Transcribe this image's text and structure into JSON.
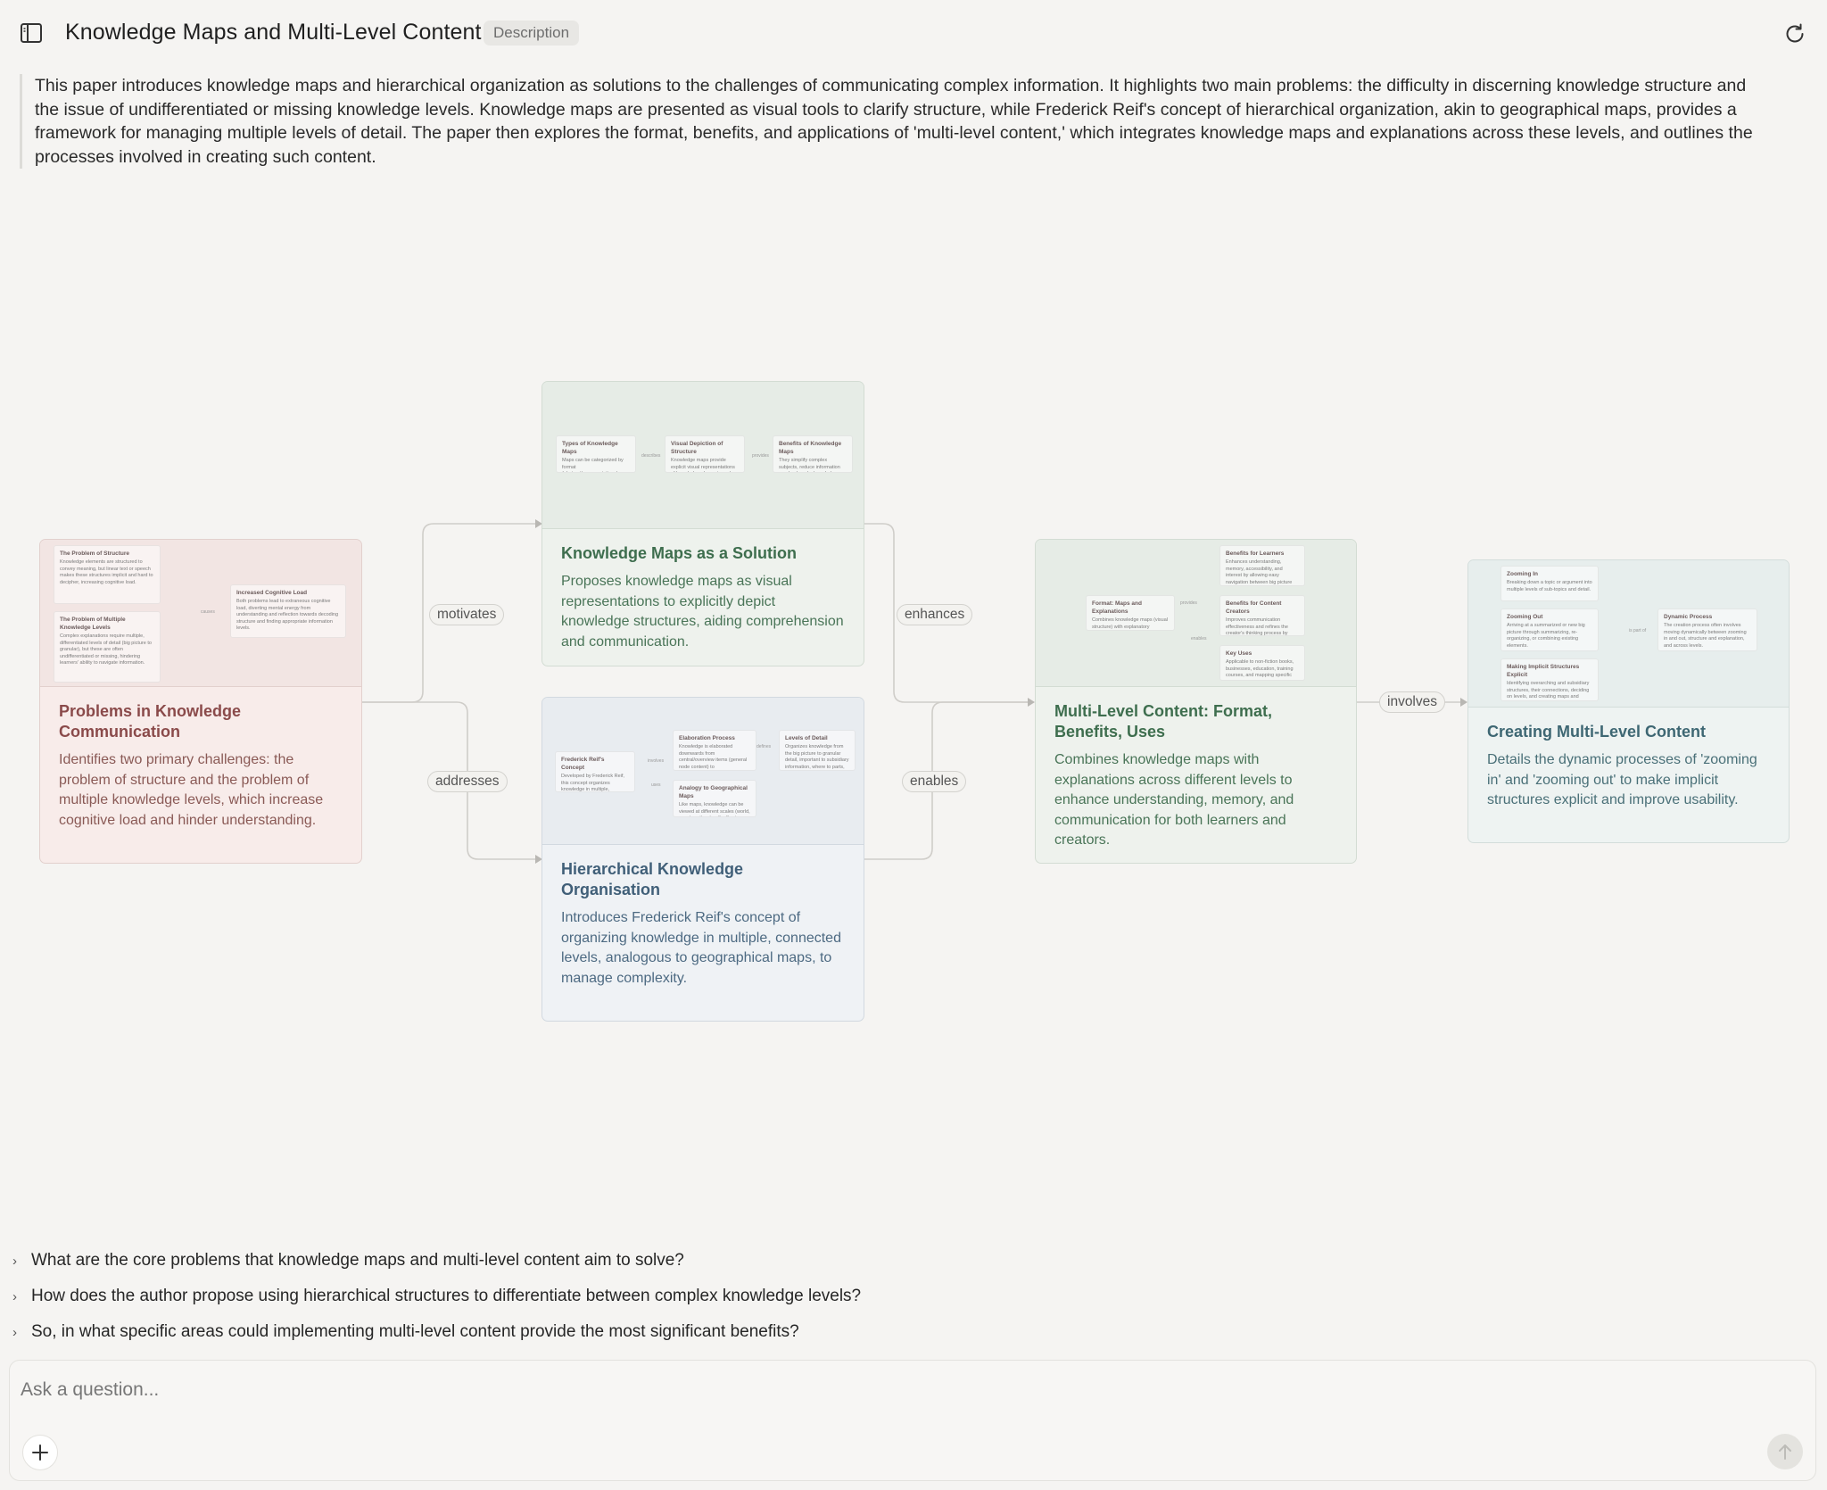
{
  "header": {
    "title": "Knowledge Maps and Multi-Level Content",
    "tag": "Description"
  },
  "description": "This paper introduces knowledge maps and hierarchical organization as solutions to the challenges of communicating complex information. It highlights two main problems: the difficulty in discerning knowledge structure and the issue of undifferentiated or missing knowledge levels. Knowledge maps are presented as visual tools to clarify structure, while Frederick Reif's concept of hierarchical organization, akin to geographical maps, provides a framework for managing multiple levels of detail. The paper then explores the format, benefits, and applications of 'multi-level content,' which integrates knowledge maps and explanations across these levels, and outlines the processes involved in creating such content.",
  "edges": {
    "motivates": "motivates",
    "addresses": "addresses",
    "enhances": "enhances",
    "enables": "enables",
    "involves": "involves"
  },
  "nodes": {
    "problems": {
      "title": "Problems in Knowledge Communication",
      "desc": "Identifies two primary challenges: the problem of structure and the problem of multiple knowledge levels, which increase cognitive load and hinder understanding.",
      "preview": {
        "c1": {
          "t": "The Problem of Structure",
          "d": "Knowledge elements are structured to convey meaning, but linear text or speech makes these structures implicit and hard to decipher, increasing cognitive load."
        },
        "c2": {
          "t": "The Problem of Multiple Knowledge Levels",
          "d": "Complex explanations require multiple, differentiated levels of detail (big picture to granular), but these are often undifferentiated or missing, hindering learners' ability to navigate information."
        },
        "c3": {
          "t": "Increased Cognitive Load",
          "d": "Both problems lead to extraneous cognitive load, diverting mental energy from understanding and reflection towards decoding structure and finding appropriate information levels."
        },
        "l1": "causes"
      }
    },
    "maps": {
      "title": "Knowledge Maps as a Solution",
      "desc": "Proposes knowledge maps as visual representations to explicitly depict knowledge structures, aiding comprehension and communication.",
      "preview": {
        "c1": {
          "t": "Types of Knowledge Maps",
          "d": "Maps can be categorized by format (abstract/representational graphics, text) and by the knowledge structures they employ (taxonomy, timeline, description, etc.)."
        },
        "c2": {
          "t": "Visual Depiction of Structure",
          "d": "Knowledge maps provide explicit visual representations of knowledge elements and their relationships, making structure immediately apparent."
        },
        "c3": {
          "t": "Benefits of Knowledge Maps",
          "d": "They simplify complex subjects, reduce information overload, make knowledge more accessible and coherent, and can stimulate new knowledge creation."
        },
        "l1": "describes",
        "l2": "provides"
      }
    },
    "hier": {
      "title": "Hierarchical Knowledge Organisation",
      "desc": "Introduces Frederick Reif's concept of organizing knowledge in multiple, connected levels, analogous to geographical maps, to manage complexity.",
      "preview": {
        "c1": {
          "t": "Frederick Reif's Concept",
          "d": "Developed by Frederick Reif, this concept organizes knowledge in multiple, interconnected levels, analogous to geographical maps, to manage complexity."
        },
        "c2": {
          "t": "Elaboration Process",
          "d": "Knowledge is elaborated downwards from central/overview items (general node content) to subordinate/subsidiary (with specific) in smaller forms."
        },
        "c3": {
          "t": "Levels of Detail",
          "d": "Organizes knowledge from the big picture to granular detail, important to subsidiary information, where to parts, general to specific and wide context to narrow focus."
        },
        "c4": {
          "t": "Analogy to Geographical Maps",
          "d": "Like maps, knowledge can be viewed at different scales (world, country, city, street), allowing users to zoom in or out as needed."
        },
        "l1": "involves",
        "l2": "uses",
        "l3": "defines"
      }
    },
    "multi": {
      "title": "Multi-Level Content: Format, Benefits, Uses",
      "desc": "Combines knowledge maps with explanations across different levels to enhance understanding, memory, and communication for both learners and creators.",
      "preview": {
        "c1": {
          "t": "Format: Maps and Explanations",
          "d": "Combines knowledge maps (visual structure) with explanatory summaries (textual detail) across different hierarchical levels."
        },
        "c2": {
          "t": "Benefits for Learners",
          "d": "Enhances understanding, memory, accessibility, and interest by allowing easy navigation between big picture and detail and reducing cognitive load."
        },
        "c3": {
          "t": "Benefits for Content Creators",
          "d": "Improves communication effectiveness and refines the creator's thinking process by forcing clarification of relationships and identification of gaps."
        },
        "c4": {
          "t": "Key Uses",
          "d": "Applicable to non-fiction books, businesses, education, training courses, and mapping specific knowledge areas."
        },
        "l1": "provides",
        "l2": "enables"
      }
    },
    "create": {
      "title": "Creating Multi-Level Content",
      "desc": "Details the dynamic processes of 'zooming in' and 'zooming out' to make implicit structures explicit and improve usability.",
      "preview": {
        "c1": {
          "t": "Zooming In",
          "d": "Breaking down a topic or argument into multiple levels of sub-topics and detail."
        },
        "c2": {
          "t": "Zooming Out",
          "d": "Arriving at a summarized or new big picture through summarizing, re-organizing, or combining existing elements."
        },
        "c3": {
          "t": "Making Implicit Structures Explicit",
          "d": "Identifying overarching and subsidiary structures, their connections, deciding on levels, and creating maps and summaries."
        },
        "c4": {
          "t": "Dynamic Process",
          "d": "The creation process often involves moving dynamically between zooming in and out, structure and explanation, and across levels."
        },
        "l1": "is part of"
      }
    }
  },
  "questions": [
    "What are the core problems that knowledge maps and multi-level content aim to solve?",
    "How does the author propose using hierarchical structures to differentiate between complex knowledge levels?",
    "So, in what specific areas could implementing multi-level content provide the most significant benefits?"
  ],
  "ask": {
    "placeholder": "Ask a question...",
    "plus": "+"
  },
  "icons": {
    "sidebar": "sidebar-toggle-icon",
    "refresh": "refresh-icon",
    "plus": "plus-icon",
    "send": "arrow-up-icon",
    "chevron": "chevron-right-icon"
  },
  "colors": {
    "background": "#f5f4f2",
    "red_title": "#8a4a4a",
    "green_title": "#3e6e4e",
    "blue_title": "#405f78",
    "teal_title": "#3e6773"
  }
}
